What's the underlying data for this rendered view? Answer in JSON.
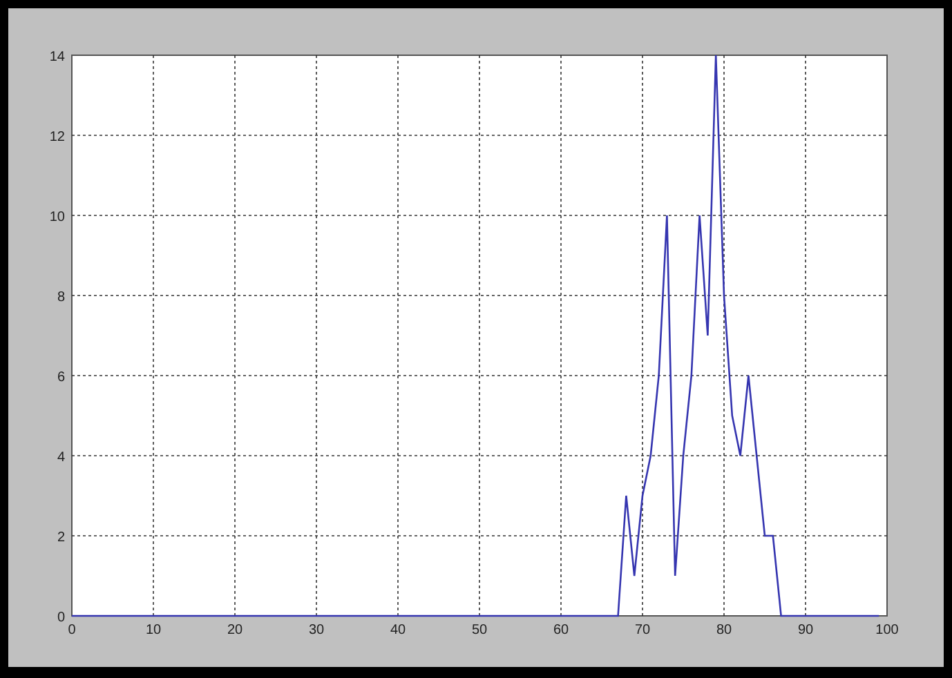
{
  "figure": {
    "chart_data": {
      "type": "line",
      "x": [
        0,
        1,
        2,
        3,
        4,
        5,
        6,
        7,
        8,
        9,
        10,
        11,
        12,
        13,
        14,
        15,
        16,
        17,
        18,
        19,
        20,
        21,
        22,
        23,
        24,
        25,
        26,
        27,
        28,
        29,
        30,
        31,
        32,
        33,
        34,
        35,
        36,
        37,
        38,
        39,
        40,
        41,
        42,
        43,
        44,
        45,
        46,
        47,
        48,
        49,
        50,
        51,
        52,
        53,
        54,
        55,
        56,
        57,
        58,
        59,
        60,
        61,
        62,
        63,
        64,
        65,
        66,
        67,
        68,
        69,
        70,
        71,
        72,
        73,
        74,
        75,
        76,
        77,
        78,
        79,
        80,
        81,
        82,
        83,
        84,
        85,
        86,
        87,
        88,
        89,
        90,
        91,
        92,
        93,
        94,
        95,
        96,
        97,
        98,
        99
      ],
      "series": [
        {
          "color": "#3535b0",
          "values": [
            0,
            0,
            0,
            0,
            0,
            0,
            0,
            0,
            0,
            0,
            0,
            0,
            0,
            0,
            0,
            0,
            0,
            0,
            0,
            0,
            0,
            0,
            0,
            0,
            0,
            0,
            0,
            0,
            0,
            0,
            0,
            0,
            0,
            0,
            0,
            0,
            0,
            0,
            0,
            0,
            0,
            0,
            0,
            0,
            0,
            0,
            0,
            0,
            0,
            0,
            0,
            0,
            0,
            0,
            0,
            0,
            0,
            0,
            0,
            0,
            0,
            0,
            0,
            0,
            0,
            0,
            0,
            0,
            3,
            1,
            3,
            4,
            6,
            10,
            1,
            4,
            6,
            10,
            7,
            14,
            8,
            5,
            4,
            6,
            4,
            2,
            2,
            0,
            0,
            0,
            0,
            0,
            0,
            0,
            0,
            0,
            0,
            0,
            0,
            0
          ]
        }
      ],
      "xlim": [
        0,
        100
      ],
      "ylim": [
        0,
        14
      ],
      "xticks": [
        0,
        10,
        20,
        30,
        40,
        50,
        60,
        70,
        80,
        90,
        100
      ],
      "yticks": [
        0,
        2,
        4,
        6,
        8,
        10,
        12,
        14
      ],
      "grid": true
    }
  }
}
